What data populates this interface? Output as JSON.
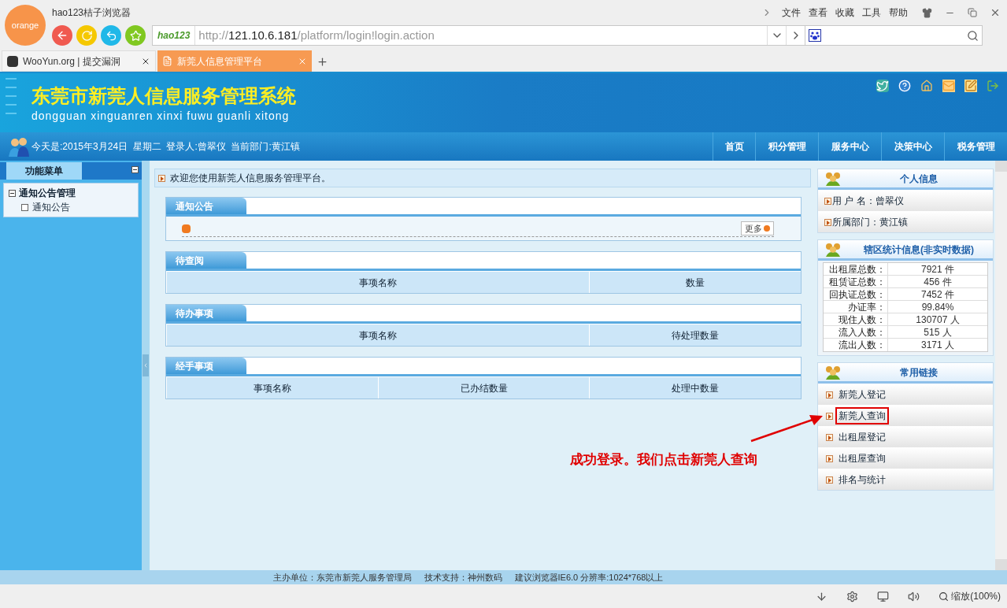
{
  "browser": {
    "brand": "orange",
    "title": "hao123桔子浏览器",
    "menu": [
      "文件",
      "查看",
      "收藏",
      "工具",
      "帮助"
    ],
    "address": {
      "logo": "hao123",
      "scheme": "http://",
      "host": "121.10.6.181",
      "path": "/platform/login!login.action"
    },
    "tabs": [
      {
        "label": "WooYun.org | 提交漏洞",
        "selected": false
      },
      {
        "label": "新莞人信息管理平台",
        "selected": true
      }
    ],
    "status_bar": {
      "zoom": "缩放(100%)"
    }
  },
  "site": {
    "title": "东莞市新莞人信息服务管理系统",
    "subtitle": "dongguan xinguanren xinxi fuwu guanli xitong",
    "info": "今天是:2015年3月24日  星期二  登录人:曾翠仪  当前部门:黄江镇",
    "nav": [
      "首页",
      "积分管理",
      "服务中心",
      "决策中心",
      "税务管理"
    ],
    "sidebar": {
      "title": "功能菜单",
      "groups": [
        {
          "label": "通知公告管理",
          "expanded": true,
          "children": [
            {
              "label": "通知公告"
            }
          ]
        }
      ]
    },
    "welcome": "欢迎您使用新莞人信息服务管理平台。",
    "sections": [
      {
        "kind": "notice",
        "title": "通知公告",
        "more": "更多"
      },
      {
        "kind": "table",
        "title": "待查阅",
        "columns": [
          "事项名称",
          "数量"
        ]
      },
      {
        "kind": "table",
        "title": "待办事项",
        "columns": [
          "事项名称",
          "待处理数量"
        ]
      },
      {
        "kind": "table",
        "title": "经手事项",
        "columns": [
          "事项名称",
          "已办结数量",
          "处理中数量"
        ]
      }
    ],
    "personal": {
      "title": "个人信息",
      "rows": [
        "用 户 名：曾翠仪",
        "所属部门：黄江镇"
      ]
    },
    "stats": {
      "title": "辖区统计信息(非实时数据)",
      "rows": [
        {
          "label": "出租屋总数：",
          "value": "7921 件"
        },
        {
          "label": "租赁证总数：",
          "value": "456 件"
        },
        {
          "label": "回执证总数：",
          "value": "7452 件"
        },
        {
          "label": "办证率：",
          "value": "99.84%"
        },
        {
          "label": "现住人数：",
          "value": "130707 人"
        },
        {
          "label": "流入人数：",
          "value": "515 人"
        },
        {
          "label": "流出人数：",
          "value": "3171 人"
        }
      ]
    },
    "links": {
      "title": "常用链接",
      "items": [
        {
          "label": "新莞人登记",
          "highlighted": false
        },
        {
          "label": "新莞人查询",
          "highlighted": true
        },
        {
          "label": "出租屋登记",
          "highlighted": false
        },
        {
          "label": "出租屋查询",
          "highlighted": false
        },
        {
          "label": "排名与统计",
          "highlighted": false
        }
      ]
    },
    "annotation": "成功登录。我们点击新莞人查询",
    "footer": [
      "主办单位：东莞市新莞人服务管理局",
      "技术支持：神州数码",
      "建议浏览器IE6.0 分辨率:1024*768以上"
    ]
  }
}
